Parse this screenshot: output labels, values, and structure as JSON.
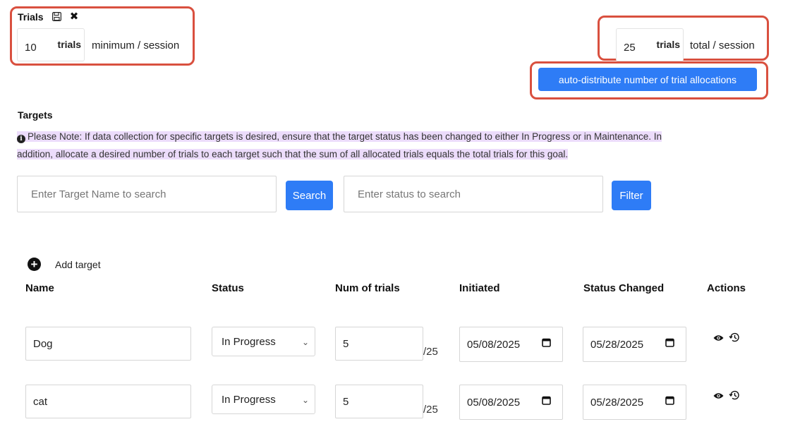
{
  "trials": {
    "title": "Trials",
    "minimum_value": "10",
    "minimum_unit": "trials",
    "minimum_label": "minimum / session",
    "total_value": "25",
    "total_unit": "trials",
    "total_label": "total / session",
    "auto_distribute_label": "auto-distribute number of trial allocations"
  },
  "targets": {
    "title": "Targets",
    "note_line1": "Please Note: If data collection for specific targets is desired, ensure that the target status has been changed to either In Progress or in Maintenance. In",
    "note_line2": "addition, allocate a desired number of trials to each target such that the sum of all allocated trials equals the total trials for this goal."
  },
  "search": {
    "name_placeholder": "Enter Target Name to search",
    "search_label": "Search",
    "status_placeholder": "Enter status to search",
    "filter_label": "Filter"
  },
  "add_target_label": "Add target",
  "table": {
    "headers": [
      "Name",
      "Status",
      "Num of trials",
      "Initiated",
      "Status Changed",
      "Actions"
    ],
    "rows": [
      {
        "name": "Dog",
        "status": "In Progress",
        "trials": "5",
        "denominator": "/25",
        "initiated": "05/08/2025",
        "status_changed": "05/28/2025"
      },
      {
        "name": "cat",
        "status": "In Progress",
        "trials": "5",
        "denominator": "/25",
        "initiated": "05/08/2025",
        "status_changed": "05/28/2025"
      }
    ]
  },
  "colors": {
    "highlight_border": "#d9503f",
    "primary_button": "#2e7cf6",
    "note_highlight": "#ecdcfb"
  }
}
